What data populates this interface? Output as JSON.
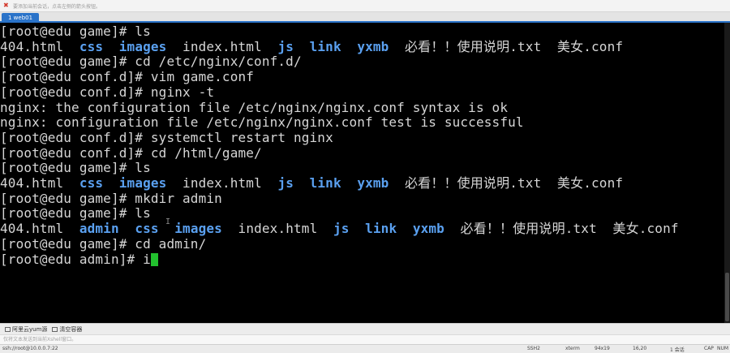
{
  "window": {
    "hint": "要添加当前会话，点击左侧的箭头按钮。"
  },
  "tabs": [
    {
      "label": "1 web01"
    }
  ],
  "terminal": {
    "dir_color": "#5aa0f0",
    "cursor_color": "#22c12e",
    "lines": [
      {
        "segs": [
          {
            "t": "[root@edu game]# ls"
          }
        ]
      },
      {
        "segs": [
          {
            "t": "404.html  "
          },
          {
            "t": "css",
            "d": 1
          },
          {
            "t": "  "
          },
          {
            "t": "images",
            "d": 1
          },
          {
            "t": "  index.html  "
          },
          {
            "t": "js",
            "d": 1
          },
          {
            "t": "  "
          },
          {
            "t": "link",
            "d": 1
          },
          {
            "t": "  "
          },
          {
            "t": "yxmb",
            "d": 1
          },
          {
            "t": "  必看！！使用说明.txt  美女.conf"
          }
        ]
      },
      {
        "segs": [
          {
            "t": "[root@edu game]# cd /etc/nginx/conf.d/"
          }
        ]
      },
      {
        "segs": [
          {
            "t": "[root@edu conf.d]# vim game.conf"
          }
        ]
      },
      {
        "segs": [
          {
            "t": "[root@edu conf.d]# nginx -t"
          }
        ]
      },
      {
        "segs": [
          {
            "t": "nginx: the configuration file /etc/nginx/nginx.conf syntax is ok"
          }
        ]
      },
      {
        "segs": [
          {
            "t": "nginx: configuration file /etc/nginx/nginx.conf test is successful"
          }
        ]
      },
      {
        "segs": [
          {
            "t": "[root@edu conf.d]# systemctl restart nginx"
          }
        ]
      },
      {
        "segs": [
          {
            "t": "[root@edu conf.d]# cd /html/game/"
          }
        ]
      },
      {
        "segs": [
          {
            "t": "[root@edu game]# ls"
          }
        ]
      },
      {
        "segs": [
          {
            "t": "404.html  "
          },
          {
            "t": "css",
            "d": 1
          },
          {
            "t": "  "
          },
          {
            "t": "images",
            "d": 1
          },
          {
            "t": "  index.html  "
          },
          {
            "t": "js",
            "d": 1
          },
          {
            "t": "  "
          },
          {
            "t": "link",
            "d": 1
          },
          {
            "t": "  "
          },
          {
            "t": "yxmb",
            "d": 1
          },
          {
            "t": "  必看！！使用说明.txt  美女.conf"
          }
        ]
      },
      {
        "segs": [
          {
            "t": "[root@edu game]# mkdir admin"
          }
        ]
      },
      {
        "segs": [
          {
            "t": "[root@edu game]# ls"
          }
        ]
      },
      {
        "segs": [
          {
            "t": "404.html  "
          },
          {
            "t": "admin",
            "d": 1
          },
          {
            "t": "  "
          },
          {
            "t": "css",
            "d": 1
          },
          {
            "t": "  "
          },
          {
            "t": "images",
            "d": 1
          },
          {
            "t": "  index.html  "
          },
          {
            "t": "js",
            "d": 1
          },
          {
            "t": "  "
          },
          {
            "t": "link",
            "d": 1
          },
          {
            "t": "  "
          },
          {
            "t": "yxmb",
            "d": 1
          },
          {
            "t": "  必看！！使用说明.txt  美女.conf"
          }
        ]
      },
      {
        "segs": [
          {
            "t": "[root@edu game]# cd admin/"
          }
        ]
      },
      {
        "segs": [
          {
            "t": "[root@edu admin]# i"
          }
        ],
        "cursor": true
      }
    ]
  },
  "bottom_buttons": [
    {
      "label": "阿里云yum源",
      "icon": "folder-icon"
    },
    {
      "label": "清空容器",
      "icon": "clear-icon"
    }
  ],
  "send_bar": {
    "placeholder": "仅将文本发送到当前Xshell窗口。"
  },
  "status": {
    "connection": "ssh://root@10.0.0.7:22",
    "protocol": "SSH2",
    "terminal": "xterm",
    "size": "94x19",
    "cursor_pos": "16,20",
    "sessions": "1 会话",
    "cap": "CAP",
    "num": "NUM"
  }
}
